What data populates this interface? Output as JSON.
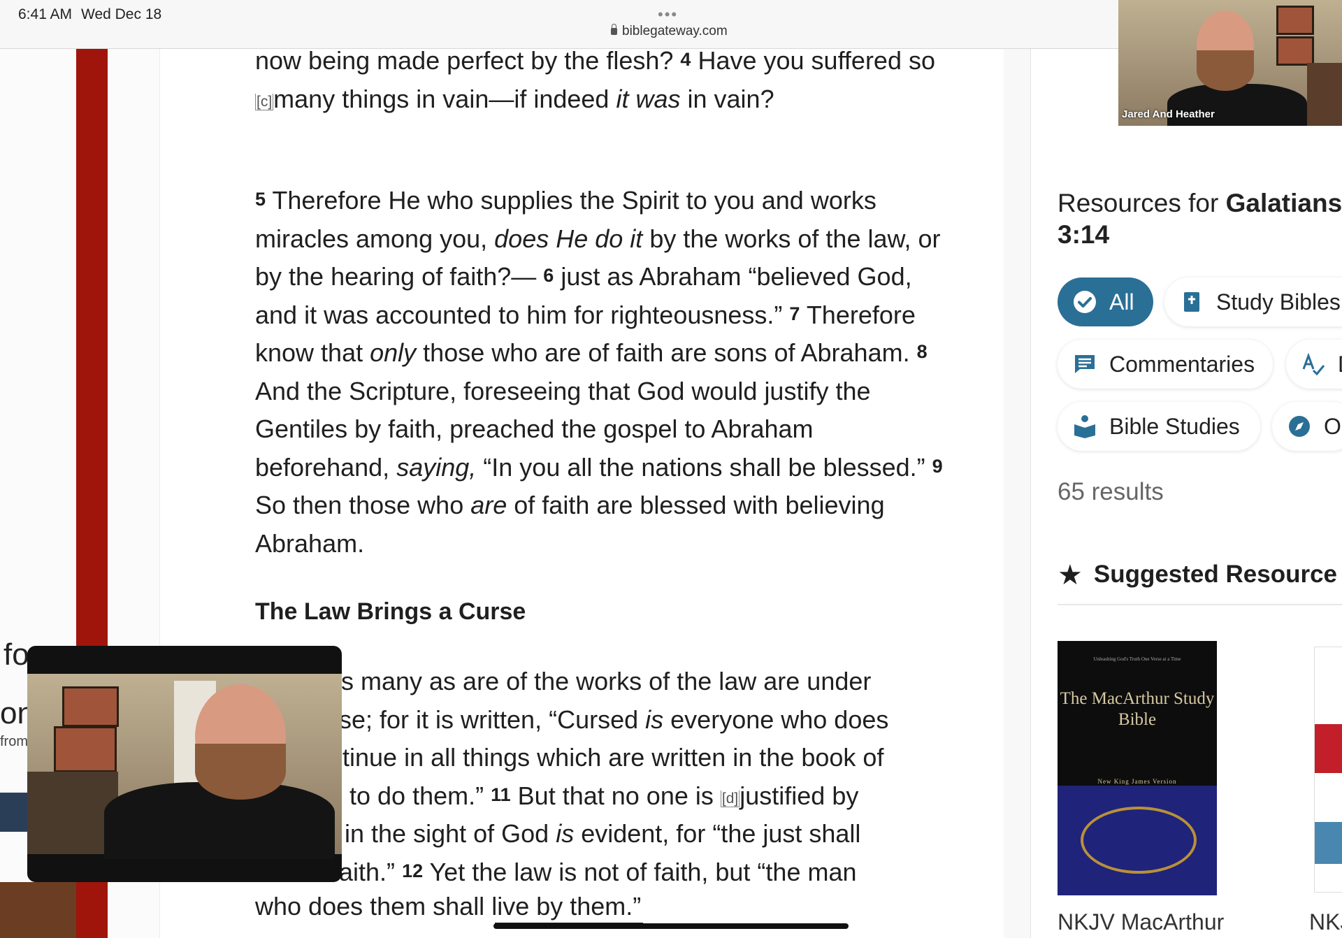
{
  "status": {
    "time": "6:41 AM",
    "date": "Wed Dec 18",
    "url": "biblegateway.com",
    "dots": "•••"
  },
  "passage": {
    "p1": [
      "now being made perfect by the flesh?",
      "4",
      "Have you suffered so",
      "[c]",
      "many things in vain—if indeed",
      "it was",
      "in vain?"
    ],
    "p2": {
      "v5": "5",
      "t5a": "Therefore He who supplies the Spirit to you and works miracles among you,",
      "t5i": "does He do it",
      "t5b": "by the works of the law, or by the hearing of faith?—",
      "v6": "6",
      "t6": "just as Abraham “believed God, and it was accounted to him for righteousness.”",
      "v7": "7",
      "t7a": "Therefore know that",
      "t7i": "only",
      "t7b": "those who are of faith are sons of Abraham.",
      "v8": "8",
      "t8a": "And the Scripture, foreseeing that God would justify the Gentiles by faith, preached the gospel to Abraham beforehand,",
      "t8i": "saying,",
      "t8b": "“In you all the nations shall be blessed.”",
      "v9": "9",
      "t9a": "So then those who",
      "t9i": "are",
      "t9b": "of faith are blessed with believing Abraham."
    },
    "heading": "The Law Brings a Curse",
    "p3": {
      "l1": "s many as are of the works of the law are under",
      "l2a": "se; for it is written, “Cursed",
      "l2i": "is",
      "l2b": "everyone who does",
      "l3": "tinue in all things which are written in the book of",
      "l4a": "to do them.”",
      "l4v": "11",
      "l4b": "But that no one is",
      "l4f": "[d]",
      "l4c": "justified by",
      "l5a": "in the sight of God",
      "l5i": "is",
      "l5b": "evident, for “the just shall",
      "l6a": "aith.”",
      "l6v": "12",
      "l6b": "Yet the law is not of faith, but “the man"
    },
    "p4a": "who does them shall",
    "p4b": "live by them.”"
  },
  "sidebar": {
    "resources_prefix": "Resources for",
    "resources_ref": "Galatians 3:14",
    "filters": {
      "all": "All",
      "study_bibles": "Study Bibles",
      "commentaries": "Commentaries",
      "d": "D",
      "bible_studies": "Bible Studies",
      "o": "O"
    },
    "results": "65 results",
    "suggested": "Suggested Resource",
    "book1": {
      "top": "Unleashing God's Truth One Verse at a Time",
      "title": "The MacArthur Study Bible",
      "sub": "New King James Version",
      "caption": "NKJV MacArthur"
    },
    "book2": {
      "caption": "NKJ"
    }
  },
  "video": {
    "name": "Jared And Heather"
  },
  "left": {
    "t1": "fo",
    "t2": "on",
    "t3": "from"
  },
  "colors": {
    "accent": "#2a6f96",
    "red_bar": "#a0150b"
  },
  "icons": [
    "lock-icon",
    "check-circle-icon",
    "bible-icon",
    "comment-icon",
    "dictionary-icon",
    "study-icon",
    "compass-icon",
    "star-icon"
  ]
}
